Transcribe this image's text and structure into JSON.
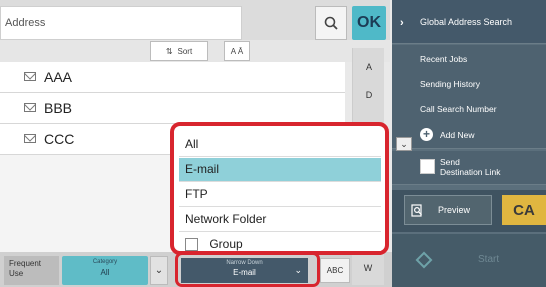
{
  "search": {
    "placeholder": "Address",
    "ok_label": "OK"
  },
  "sort": {
    "sort_label": "Sort",
    "az_label": "A Ā"
  },
  "list": {
    "items": [
      {
        "label": "AAA"
      },
      {
        "label": "BBB"
      },
      {
        "label": "CCC"
      }
    ]
  },
  "index": {
    "letters": [
      "A",
      "D"
    ]
  },
  "right_panel": {
    "global_search": "Global Address Search",
    "recent_jobs": "Recent Jobs",
    "sending_history": "Sending History",
    "call_search_number": "Call Search Number",
    "add_new": "Add New",
    "send_destination_link_1": "Send",
    "send_destination_link_2": "Destination Link",
    "preview": "Preview",
    "ca": "CA",
    "start": "Start"
  },
  "bottom": {
    "frequent_use_1": "Frequent",
    "frequent_use_2": "Use",
    "category_small": "Category",
    "category_value": "All",
    "narrow_small": "Narrow Down",
    "narrow_value": "E-mail",
    "abc": "ABC",
    "w": "W"
  },
  "dropdown": {
    "options": [
      "All",
      "E-mail",
      "FTP",
      "Network Folder",
      "Group"
    ],
    "selected": "E-mail"
  },
  "colors": {
    "accent": "#4fb9c8",
    "highlight": "#d8252e",
    "panel": "#4e6270",
    "ca": "#e0b640"
  }
}
